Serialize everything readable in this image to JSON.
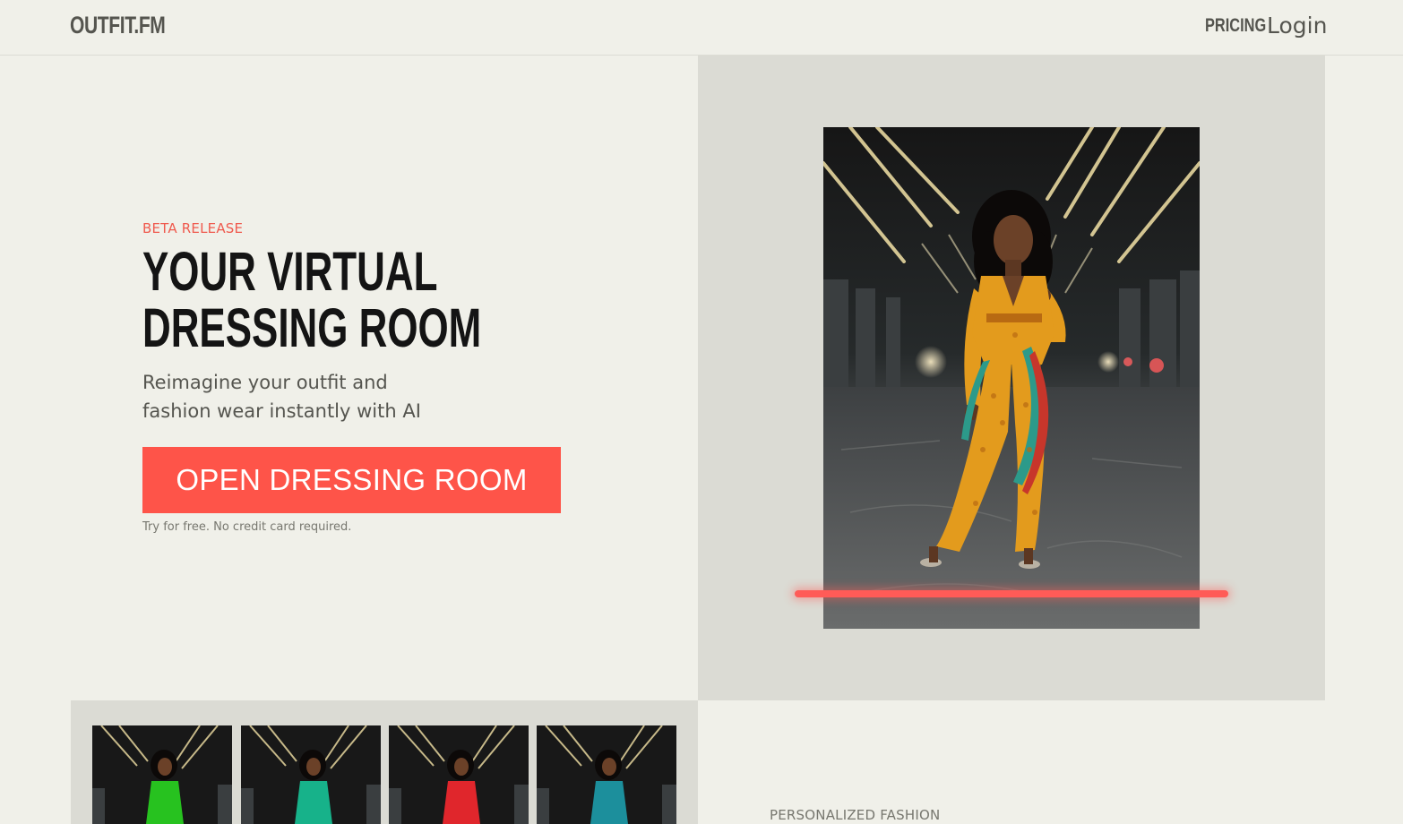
{
  "header": {
    "logo": "OUTFIT.FM",
    "nav_pricing": "PRICING",
    "nav_login": "Login"
  },
  "hero": {
    "eyebrow": "BETA RELEASE",
    "headline_lines": [
      "YOUR VIRTUAL",
      "DRESSING ROOM"
    ],
    "subline_lines": [
      "Reimagine your outfit and",
      "fashion wear instantly with AI"
    ],
    "cta_label": "OPEN DRESSING ROOM",
    "note": "Try for free. No credit card required.",
    "hero_image_alt": "Woman wearing an orange printed jumpsuit standing in an underpass"
  },
  "thumbnails": [
    {
      "name": "green-outfit",
      "outfit_color": "#27c21f"
    },
    {
      "name": "teal-outfit",
      "outfit_color": "#17b28a"
    },
    {
      "name": "red-outfit",
      "outfit_color": "#e0262c"
    },
    {
      "name": "blue-outfit",
      "outfit_color": "#1c8f9c"
    }
  ],
  "features": {
    "eyebrow": "PERSONALIZED FASHION"
  },
  "colors": {
    "accent": "#fe5449",
    "page_background": "#f0f0e9",
    "panel_background": "#dbdbd4",
    "hero_outfit": "#e39b1d"
  }
}
